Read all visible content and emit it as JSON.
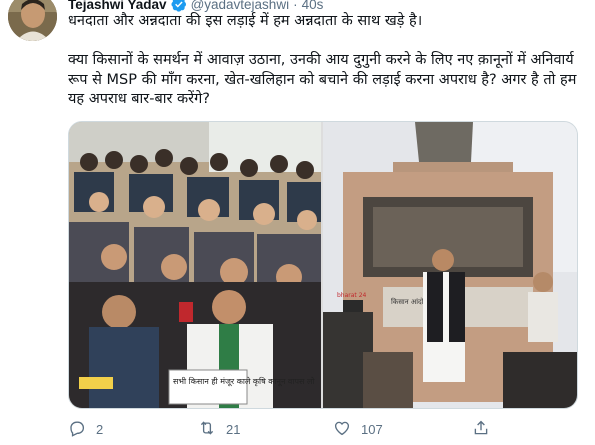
{
  "tweet": {
    "author_name": "Tejashwi Yadav",
    "handle": "@yadavtejashwi",
    "separator": "·",
    "time": "40s",
    "text_line1": "धनदाता और अन्नदाता की इस लड़ाई में हम अन्नदाता के साथ खड़े है।",
    "text_para2": "क्या किसानों के समर्थन में आवाज़ उठाना, उनकी आय दुगुनी करने के लिए नए क़ानूनों में अनिवार्य रूप से MSP की माँग करना, खेत-खलिहान को बचाने की लड़ाई करना अपराध है? अगर है तो हम यह अपराध बार-बार करेंगे?",
    "photo_placard_text": "सभी किसान ही मंजूर काले कृषि कानून वापस लो",
    "photo_banner_text": "किसान आंदोलन",
    "photo_mic_text": "bharat 24"
  },
  "actions": {
    "replies": "2",
    "retweets": "21",
    "likes": "107"
  },
  "icons": {
    "verified": "verified-badge-icon",
    "reply": "reply-icon",
    "retweet": "retweet-icon",
    "like": "heart-icon",
    "share": "share-icon"
  },
  "colors": {
    "verified": "#1d9bf0",
    "muted": "#5b7083"
  }
}
